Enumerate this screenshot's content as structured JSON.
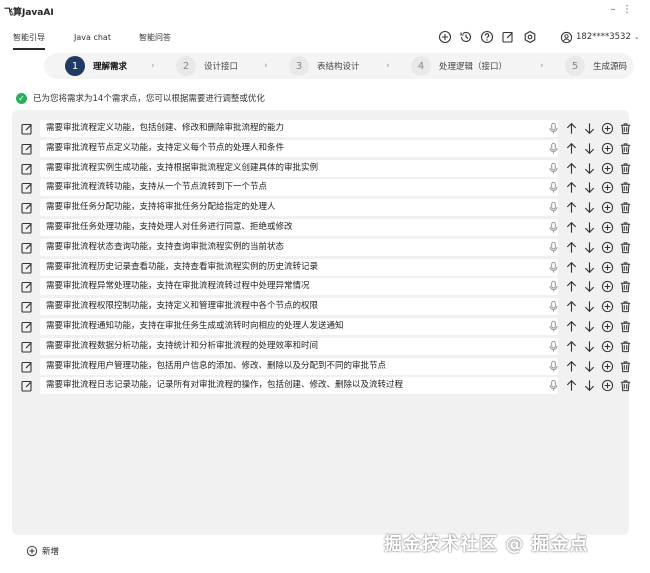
{
  "app": {
    "title": "飞算JavaAI"
  },
  "tabs": [
    {
      "label": "智能引导",
      "active": true
    },
    {
      "label": "Java chat",
      "active": false
    },
    {
      "label": "智能问答",
      "active": false
    }
  ],
  "toolbar_icons": [
    "add-icon",
    "history-icon",
    "help-icon",
    "edit-icon",
    "settings-icon"
  ],
  "user": {
    "name": "182****3532"
  },
  "steps": [
    {
      "num": "1",
      "label": "理解需求",
      "active": true
    },
    {
      "num": "2",
      "label": "设计接口",
      "active": false
    },
    {
      "num": "3",
      "label": "表结构设计",
      "active": false
    },
    {
      "num": "4",
      "label": "处理逻辑（接口）",
      "active": false
    },
    {
      "num": "5",
      "label": "生成源码",
      "active": false
    }
  ],
  "notice": "已为您将需求为14个需求点，您可以根据需要进行调整或优化",
  "requirements": [
    "需要审批流程定义功能，包括创建、修改和删除审批流程的能力",
    "需要审批流程节点定义功能，支持定义每个节点的处理人和条件",
    "需要审批流程实例生成功能，支持根据审批流程定义创建具体的审批实例",
    "需要审批流程流转功能，支持从一个节点流转到下一个节点",
    "需要审批任务分配功能，支持将审批任务分配给指定的处理人",
    "需要审批任务处理功能，支持处理人对任务进行同意、拒绝或修改",
    "需要审批流程状态查询功能，支持查询审批流程实例的当前状态",
    "需要审批流程历史记录查看功能，支持查看审批流程实例的历史流转记录",
    "需要审批流程异常处理功能，支持在审批流程流转过程中处理异常情况",
    "需要审批流程权限控制功能，支持定义和管理审批流程中各个节点的权限",
    "需要审批流程通知功能，支持在审批任务生成或流转时向相应的处理人发送通知",
    "需要审批流程数据分析功能，支持统计和分析审批流程的处理效率和时间",
    "需要审批流程用户管理功能，包括用户信息的添加、修改、删除以及分配到不同的审批节点",
    "需要审批流程日志记录功能，记录所有对审批流程的操作，包括创建、修改、删除以及流转过程"
  ],
  "row_actions": [
    "mic-icon",
    "arrow-up-icon",
    "arrow-down-icon",
    "add-circle-icon",
    "trash-icon"
  ],
  "add_new_label": "新增",
  "watermark": "掘金技术社区 @ 掘金点"
}
